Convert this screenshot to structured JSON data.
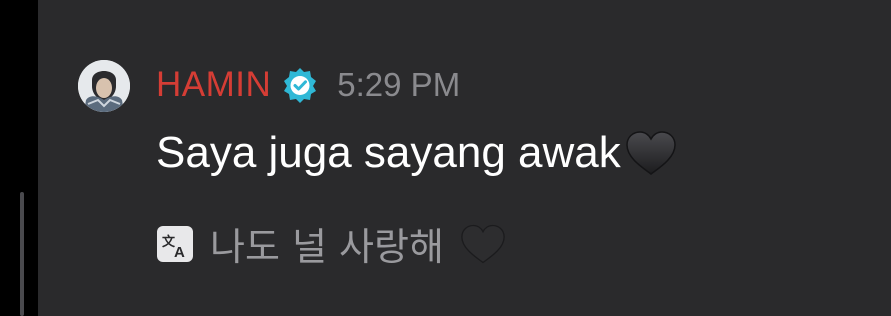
{
  "message": {
    "username": "HAMIN",
    "timestamp": "5:29 PM",
    "text": "Saya juga sayang awak",
    "translation": "나도 널 사랑해"
  },
  "icons": {
    "verified": "verified-badge-icon",
    "heart": "black-heart-emoji",
    "translate": "translate-icon"
  },
  "colors": {
    "background": "#2a2a2c",
    "username": "#d53d35",
    "verified_badge": "#2fb8d6",
    "timestamp": "#8a8a8e",
    "message_text": "#ffffff",
    "translation_text": "#9a9a9e"
  }
}
